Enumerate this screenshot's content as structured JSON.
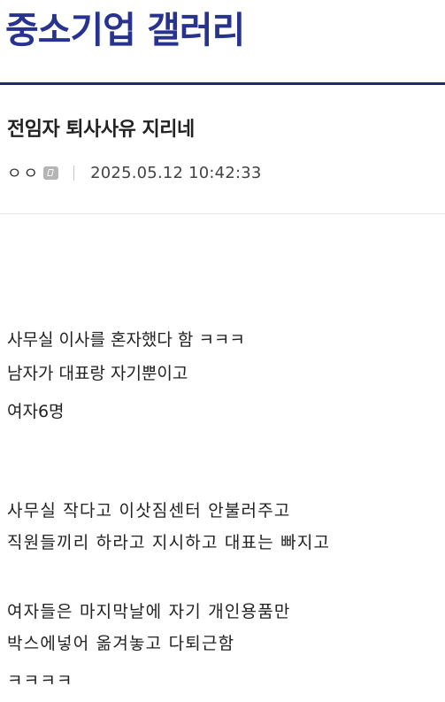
{
  "gallery": {
    "title": "중소기업 갤러리"
  },
  "post": {
    "title": "전임자 퇴사사유 지리네",
    "author": "ㅇㅇ",
    "author_icon": "writer-badge-icon",
    "date": "2025.05.12 10:42:33",
    "body_lines": [
      "사무실 이사를 혼자했다 함 ㅋㅋㅋ",
      "남자가 대표랑 자기뿐이고",
      "여자6명",
      "사무실 작다고 이삿짐센터 안불러주고",
      "직원들끼리 하라고 지시하고 대표는 빠지고",
      "여자들은 마지막날에 자기 개인용품만",
      "박스에넣어 옮겨놓고 다퇴근함",
      "ㅋㅋㅋㅋ"
    ]
  },
  "colors": {
    "title": "#27338f",
    "header_border": "#1e2a6b",
    "text": "#222222"
  }
}
